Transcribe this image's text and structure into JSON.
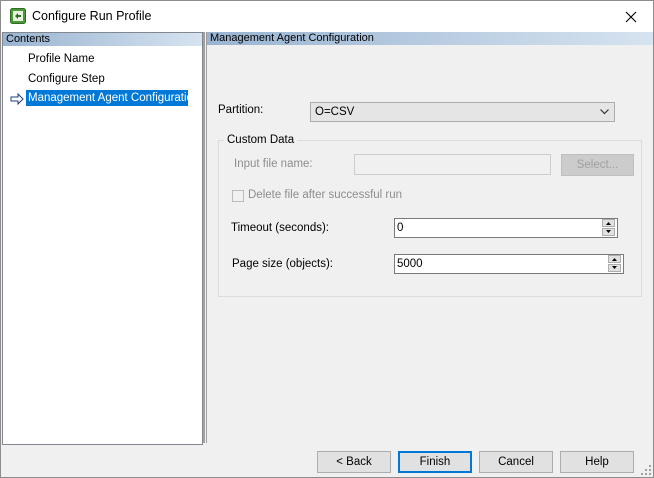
{
  "window": {
    "title": "Configure Run Profile"
  },
  "left_panel": {
    "header": "Contents",
    "items": [
      {
        "label": "Profile Name",
        "selected": false
      },
      {
        "label": "Configure Step",
        "selected": false
      },
      {
        "label": "Management Agent Configuration",
        "selected": true
      }
    ]
  },
  "right_panel": {
    "header": "Management Agent Configuration",
    "partition": {
      "label": "Partition:",
      "value": "O=CSV"
    },
    "custom_data": {
      "title": "Custom Data",
      "input_file_label": "Input file name:",
      "input_file_value": "",
      "select_button": "Select...",
      "delete_file_label": "Delete file after successful run",
      "delete_file_checked": false,
      "timeout_label": "Timeout (seconds):",
      "timeout_value": "0",
      "page_size_label": "Page size (objects):",
      "page_size_value": "5000"
    }
  },
  "footer": {
    "back_label": "< Back",
    "finish_label": "Finish",
    "cancel_label": "Cancel",
    "help_label": "Help"
  },
  "colors": {
    "selection": "#0078d7",
    "header_gradient_start": "#99b4d1",
    "header_gradient_end": "#d6e3f0",
    "app_icon": "#4a9a3a"
  }
}
